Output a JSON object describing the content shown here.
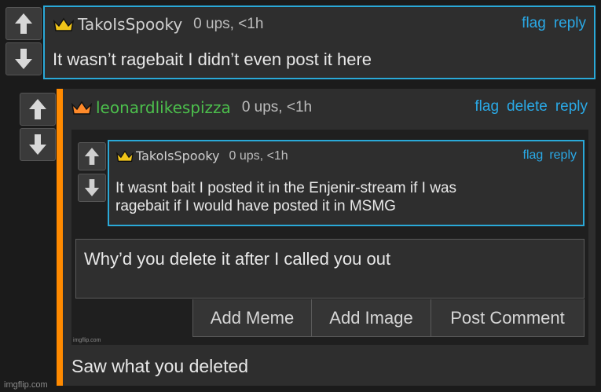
{
  "comments": [
    {
      "username": "TakoIsSpooky",
      "ups": "0 ups, <1h",
      "actions": [
        "flag",
        "reply"
      ],
      "text": "It wasn’t ragebait I didn’t even post it here"
    },
    {
      "username": "leonardlikespizza",
      "ups": "0 ups, <1h",
      "actions": [
        "flag",
        "delete",
        "reply"
      ],
      "text": "Saw what you deleted"
    }
  ],
  "quoted": {
    "username": "TakoIsSpooky",
    "ups": "0 ups, <1h",
    "actions": [
      "flag",
      "reply"
    ],
    "text_line1": "It wasnt bait I posted it in the Enjenir-stream if I was",
    "text_line2": "ragebait if I would have posted it in MSMG"
  },
  "reply_box": {
    "value": "Why’d you delete it after I called you out",
    "buttons": [
      "Add Meme",
      "Add Image",
      "Post Comment"
    ]
  },
  "watermarks": [
    "imgflip.com",
    "imgflip.com"
  ],
  "colors": {
    "link": "#2aa9e6",
    "highlight_border": "#2aa9d8",
    "username_green": "#4cbf4c",
    "orange_bar": "#ff8a00",
    "crown_gold": "#f0c419",
    "crown_orange": "#ff8a2a"
  },
  "icons": [
    "upvote-arrow-icon",
    "downvote-arrow-icon",
    "crown-icon"
  ]
}
